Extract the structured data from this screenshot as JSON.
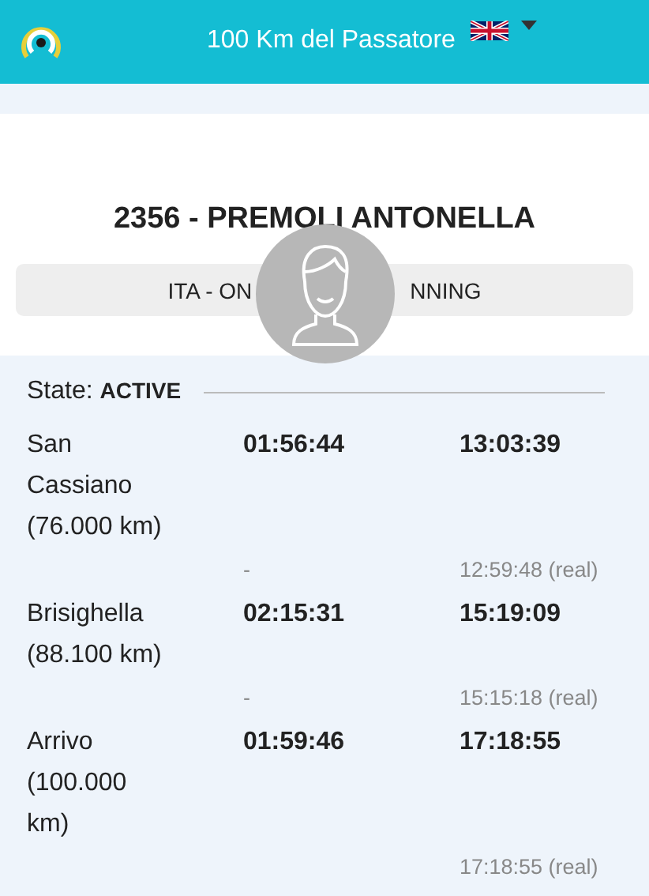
{
  "header": {
    "title": "100 Km del Passatore"
  },
  "athlete": {
    "title": "2356 - PREMOLI ANTONELLA",
    "category_left": "ITA - ON",
    "category_right": "NNING"
  },
  "state": {
    "label": "State:",
    "value": "ACTIVE"
  },
  "splits": [
    {
      "place": "San Cassiano (76.000 km)",
      "split": "01:56:44",
      "time": "13:03:39",
      "real_split": "-",
      "real_time": "12:59:48 (real)"
    },
    {
      "place": "Brisighella (88.100 km)",
      "split": "02:15:31",
      "time": "15:19:09",
      "real_split": "-",
      "real_time": "15:15:18 (real)"
    },
    {
      "place": "Arrivo (100.000 km)",
      "split": "01:59:46",
      "time": "17:18:55",
      "real_time": "17:18:55 (real)"
    }
  ]
}
